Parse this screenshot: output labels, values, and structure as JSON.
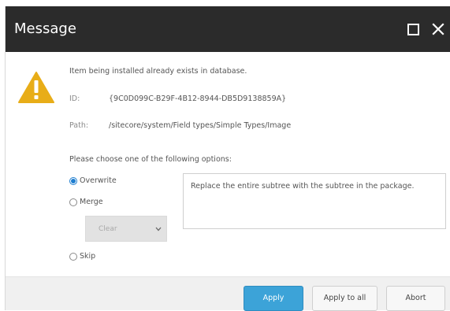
{
  "window": {
    "title": "Message",
    "maximize_icon": "maximize-icon",
    "close_icon": "close-icon"
  },
  "message": {
    "icon": "warning-icon",
    "icon_color": "#e8ad18",
    "text": "Item being installed already exists in database.",
    "id_label": "ID:",
    "id_value": "{9C0D099C-B29F-4B12-8944-DB5D9138859A}",
    "path_label": "Path:",
    "path_value": "/sitecore/system/Field types/Simple Types/Image"
  },
  "options": {
    "title": "Please choose one of the following options:",
    "overwrite_label": "Overwrite",
    "merge_label": "Merge",
    "skip_label": "Skip",
    "selected": "Overwrite",
    "merge_mode": {
      "value": "Clear",
      "disabled": true
    },
    "description": "Replace the entire subtree with the subtree in the package."
  },
  "footer": {
    "apply_label": "Apply",
    "apply_all_label": "Apply to all",
    "abort_label": "Abort"
  },
  "colors": {
    "titlebar": "#2b2b2b",
    "primary_button": "#3ca3d8",
    "radio_selected": "#1e7ed0"
  }
}
